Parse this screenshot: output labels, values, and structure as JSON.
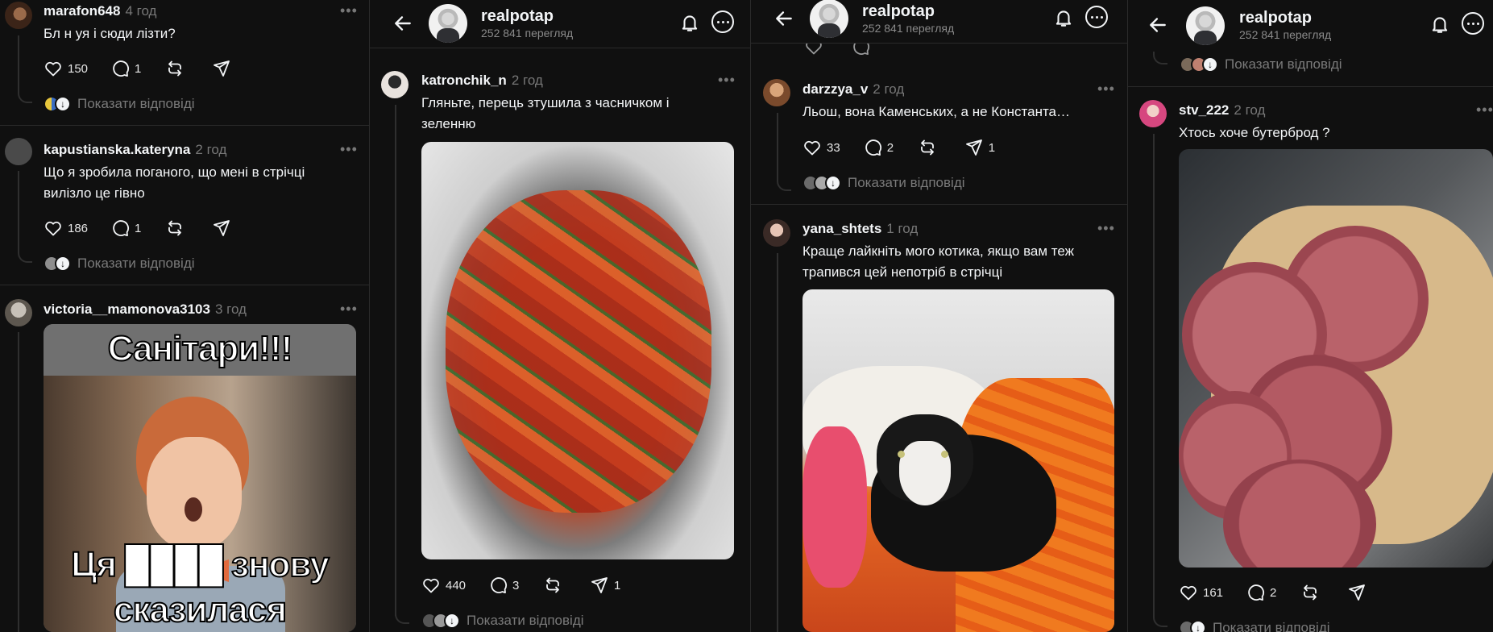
{
  "profile": {
    "name": "realpotap",
    "views": "252 841 перегляд"
  },
  "replies_label": "Показати відповіді",
  "p1": {
    "c1": {
      "user": "marafon648",
      "time": "4 год",
      "text": "Бл  н  уя і сюди лізти?",
      "likes": "150",
      "comments": "1"
    },
    "c2": {
      "user": "kapustianska.kateryna",
      "time": "2 год",
      "text1": "Що я зробила поганого, що мені в стрічці",
      "text2": "вилізло це гівно",
      "likes": "186",
      "comments": "1"
    },
    "c3": {
      "user": "victoria__mamonova3103",
      "time": "3 год",
      "meme_top": "Санітари!!!",
      "meme_bottom1": "Ця ████ знову",
      "meme_bottom2": "сказилася"
    }
  },
  "p2": {
    "c1": {
      "user": "katronchik_n",
      "time": "2 год",
      "text1": "Гляньте, перець зтушила з часничком і",
      "text2": "зеленню",
      "likes": "440",
      "comments": "3",
      "shares": "1"
    }
  },
  "p3": {
    "c1": {
      "user": "darzzya_v",
      "time": "2 год",
      "text": "Льош, вона Каменських, а не Константа…",
      "likes": "33",
      "comments": "2",
      "shares": "1"
    },
    "c2": {
      "user": "yana_shtets",
      "time": "1 год",
      "text1": "Краще лайкніть мого котика, якщо вам теж",
      "text2": "трапився цей непотріб в стрічці"
    }
  },
  "p4": {
    "c1": {
      "user": "stv_222",
      "time": "2 год",
      "text": "Хтось хоче  бутерброд ?",
      "likes": "161",
      "comments": "2"
    }
  }
}
